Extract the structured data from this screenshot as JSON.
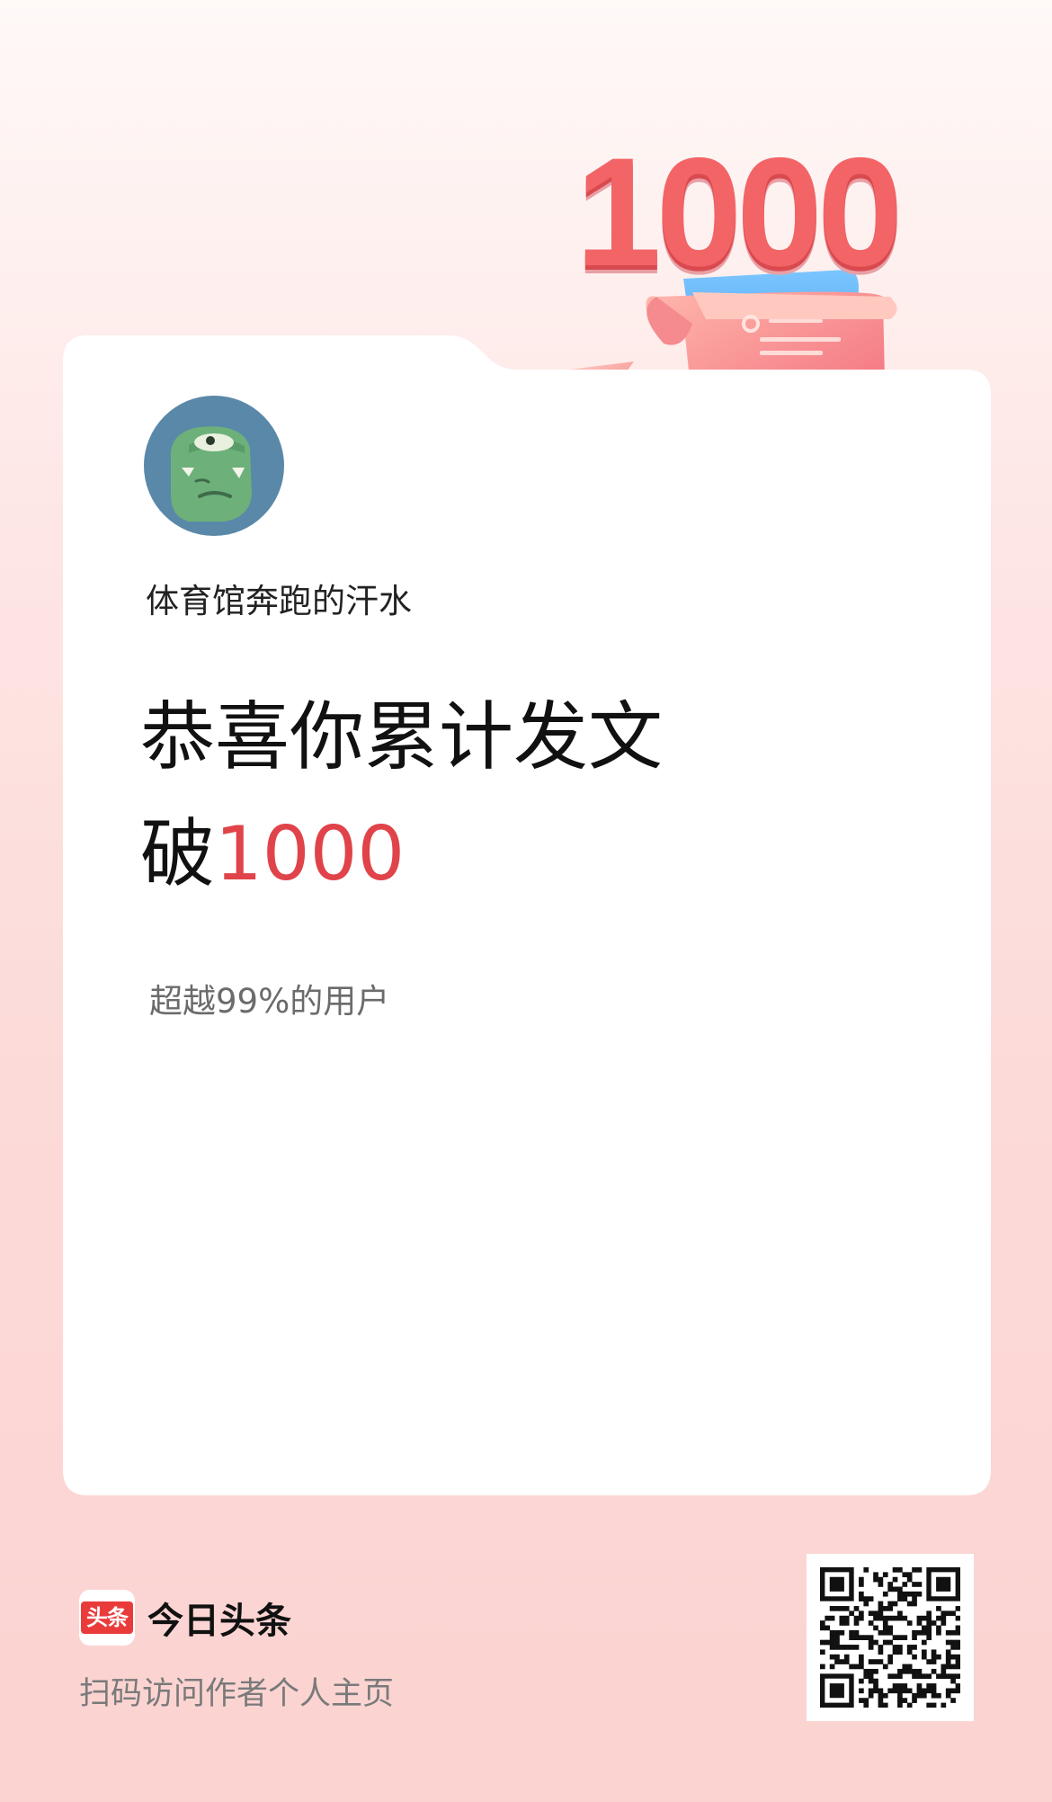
{
  "hero": {
    "number": "1000"
  },
  "card": {
    "username": "体育馆奔跑的汗水",
    "headline_line1": "恭喜你累计发文",
    "headline_prefix": "破",
    "headline_count": "1000",
    "rank_text": "超越99%的用户"
  },
  "footer": {
    "logo_badge": "头条",
    "app_name": "今日头条",
    "hint": "扫码访问作者个人主页",
    "qr_icon": "qr-code-icon"
  },
  "colors": {
    "accent_red": "#e0434a",
    "logo_red": "#ea3b3b",
    "background_top": "#fff9f8",
    "background_bottom": "#fbd3d1"
  }
}
